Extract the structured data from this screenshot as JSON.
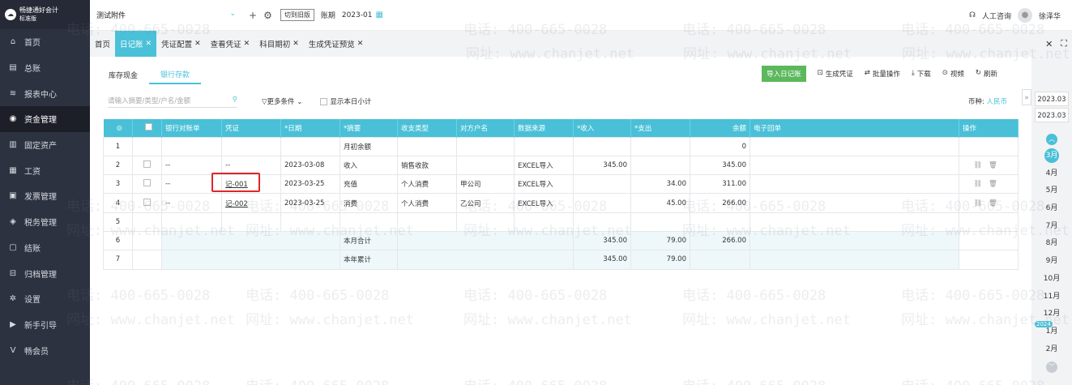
{
  "app": {
    "name": "畅捷通好会计",
    "edition": "标准版"
  },
  "sidebar": {
    "items": [
      {
        "label": "首页",
        "icon": "home-icon",
        "glyph": "⌂"
      },
      {
        "label": "总账",
        "icon": "ledger-icon",
        "glyph": "▤"
      },
      {
        "label": "报表中心",
        "icon": "chart-icon",
        "glyph": "≋"
      },
      {
        "label": "资金管理",
        "icon": "fund-icon",
        "glyph": "◉",
        "active": true
      },
      {
        "label": "固定资产",
        "icon": "asset-icon",
        "glyph": "▥"
      },
      {
        "label": "工资",
        "icon": "salary-icon",
        "glyph": "▦"
      },
      {
        "label": "发票管理",
        "icon": "invoice-icon",
        "glyph": "▣"
      },
      {
        "label": "税务管理",
        "icon": "tax-icon",
        "glyph": "◈"
      },
      {
        "label": "结账",
        "icon": "checkout-icon",
        "glyph": "▢"
      },
      {
        "label": "归档管理",
        "icon": "archive-icon",
        "glyph": "⊟"
      },
      {
        "label": "设置",
        "icon": "settings-icon",
        "glyph": "✲"
      },
      {
        "label": "新手引导",
        "icon": "guide-icon",
        "glyph": "▶"
      },
      {
        "label": "畅会员",
        "icon": "vip-icon",
        "glyph": "V"
      }
    ]
  },
  "topbar": {
    "company": "测试附件",
    "switch_label": "切到旧版",
    "period_label": "账期",
    "period_value": "2023-01",
    "support": "人工咨询",
    "user": "徐泽华"
  },
  "tabs": [
    {
      "label": "首页",
      "closable": false
    },
    {
      "label": "日记账",
      "closable": true,
      "active": true
    },
    {
      "label": "凭证配置",
      "closable": true
    },
    {
      "label": "查看凭证",
      "closable": true
    },
    {
      "label": "科目期初",
      "closable": true
    },
    {
      "label": "生成凭证预览",
      "closable": true
    }
  ],
  "subtabs": [
    "库存现金",
    "银行存款"
  ],
  "actions": {
    "import": "导入日记账",
    "generate": "生成凭证",
    "batch": "批量操作",
    "download": "下载",
    "video": "视频",
    "refresh": "刷新"
  },
  "filter": {
    "search_placeholder": "请输入摘要/类型/户名/金额",
    "more": "更多条件",
    "show_daily": "显示本日小计",
    "currency_label": "币种:",
    "currency_value": "人民币"
  },
  "table": {
    "headers": [
      "",
      "",
      "银行对账单",
      "凭证",
      "*日期",
      "*摘要",
      "收支类型",
      "对方户名",
      "数据来源",
      "*收入",
      "*支出",
      "余额",
      "电子回单",
      "操作"
    ],
    "rows": [
      {
        "no": "1",
        "stmt": "",
        "voucher": "",
        "date": "",
        "summary": "月初余额",
        "type": "",
        "party": "",
        "source": "",
        "income": "",
        "expense": "",
        "balance": "0",
        "receipt": "",
        "ops": false,
        "check": false
      },
      {
        "no": "2",
        "stmt": "--",
        "voucher": "--",
        "date": "2023-03-08",
        "summary": "收入",
        "type": "销售收款",
        "party": "",
        "source": "EXCEL导入",
        "income": "345.00",
        "expense": "",
        "balance": "345.00",
        "receipt": "",
        "ops": true,
        "check": true
      },
      {
        "no": "3",
        "stmt": "--",
        "voucher": "记-001",
        "date": "2023-03-25",
        "summary": "充值",
        "type": "个人消费",
        "party": "甲公司",
        "source": "EXCEL导入",
        "income": "",
        "expense": "34.00",
        "balance": "311.00",
        "receipt": "",
        "ops": true,
        "check": true
      },
      {
        "no": "4",
        "stmt": "--",
        "voucher": "记-002",
        "date": "2023-03-25",
        "summary": "消费",
        "type": "个人消费",
        "party": "乙公司",
        "source": "EXCEL导入",
        "income": "",
        "expense": "45.00",
        "balance": "266.00",
        "receipt": "",
        "ops": true,
        "check": true
      },
      {
        "no": "5",
        "stmt": "",
        "voucher": "",
        "date": "",
        "summary": "",
        "type": "",
        "party": "",
        "source": "",
        "income": "",
        "expense": "",
        "balance": "",
        "receipt": "",
        "ops": false,
        "check": false
      }
    ],
    "totals": [
      {
        "no": "6",
        "label": "本月合计",
        "income": "345.00",
        "expense": "79.00",
        "balance": "266.00"
      },
      {
        "no": "7",
        "label": "本年累计",
        "income": "345.00",
        "expense": "79.00",
        "balance": ""
      }
    ]
  },
  "right_panel": {
    "years": [
      "2023.03",
      "2023.03"
    ],
    "months": [
      "3月",
      "4月",
      "5月",
      "6月",
      "7月",
      "8月",
      "9月",
      "10月",
      "11月",
      "12月",
      "1月",
      "2月"
    ],
    "current_month": "3月",
    "year_badge": "2024"
  },
  "watermark": {
    "phone": "电话: 400-665-0028",
    "site": "网址: www.chanjet.net"
  },
  "colors": {
    "accent": "#49c0d7",
    "sidebar": "#2d3240",
    "import": "#5cb85c",
    "highlight": "#e0262a"
  }
}
